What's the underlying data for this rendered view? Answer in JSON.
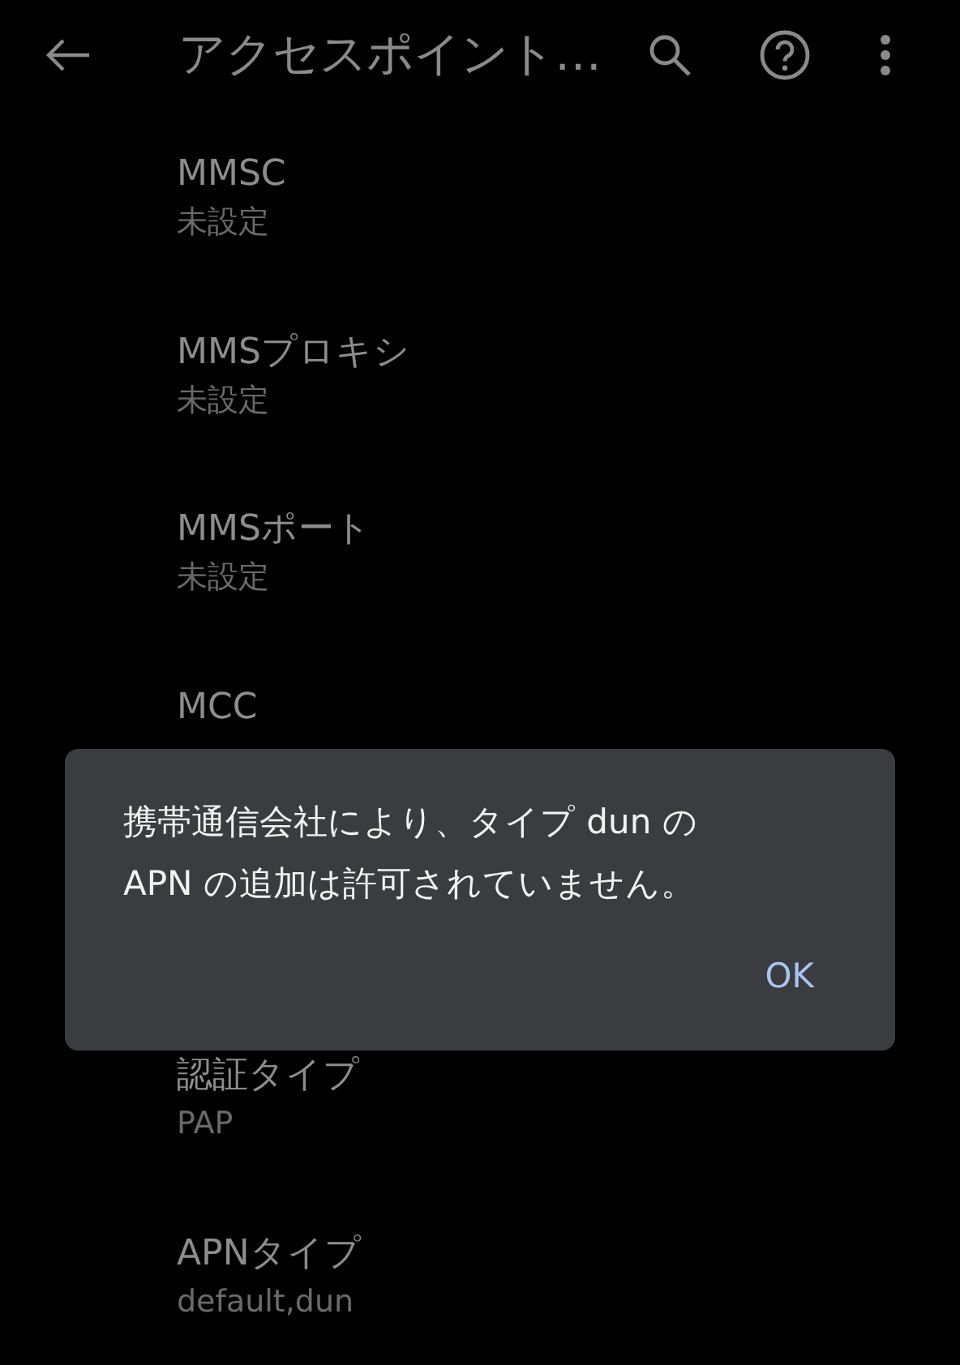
{
  "app_bar": {
    "title": "アクセスポイント…"
  },
  "settings": [
    {
      "title": "MMSC",
      "value": "未設定"
    },
    {
      "title": "MMSプロキシ",
      "value": "未設定"
    },
    {
      "title": "MMSポート",
      "value": "未設定"
    },
    {
      "title": "MCC"
    }
  ],
  "settings_after_dialog": [
    {
      "title": "認証タイプ",
      "value": "PAP"
    },
    {
      "title": "APNタイプ",
      "value": "default,dun"
    }
  ],
  "dialog": {
    "message": "携帯通信会社により、タイプ dun の APN の追加は許可されていません。",
    "button": "OK"
  }
}
